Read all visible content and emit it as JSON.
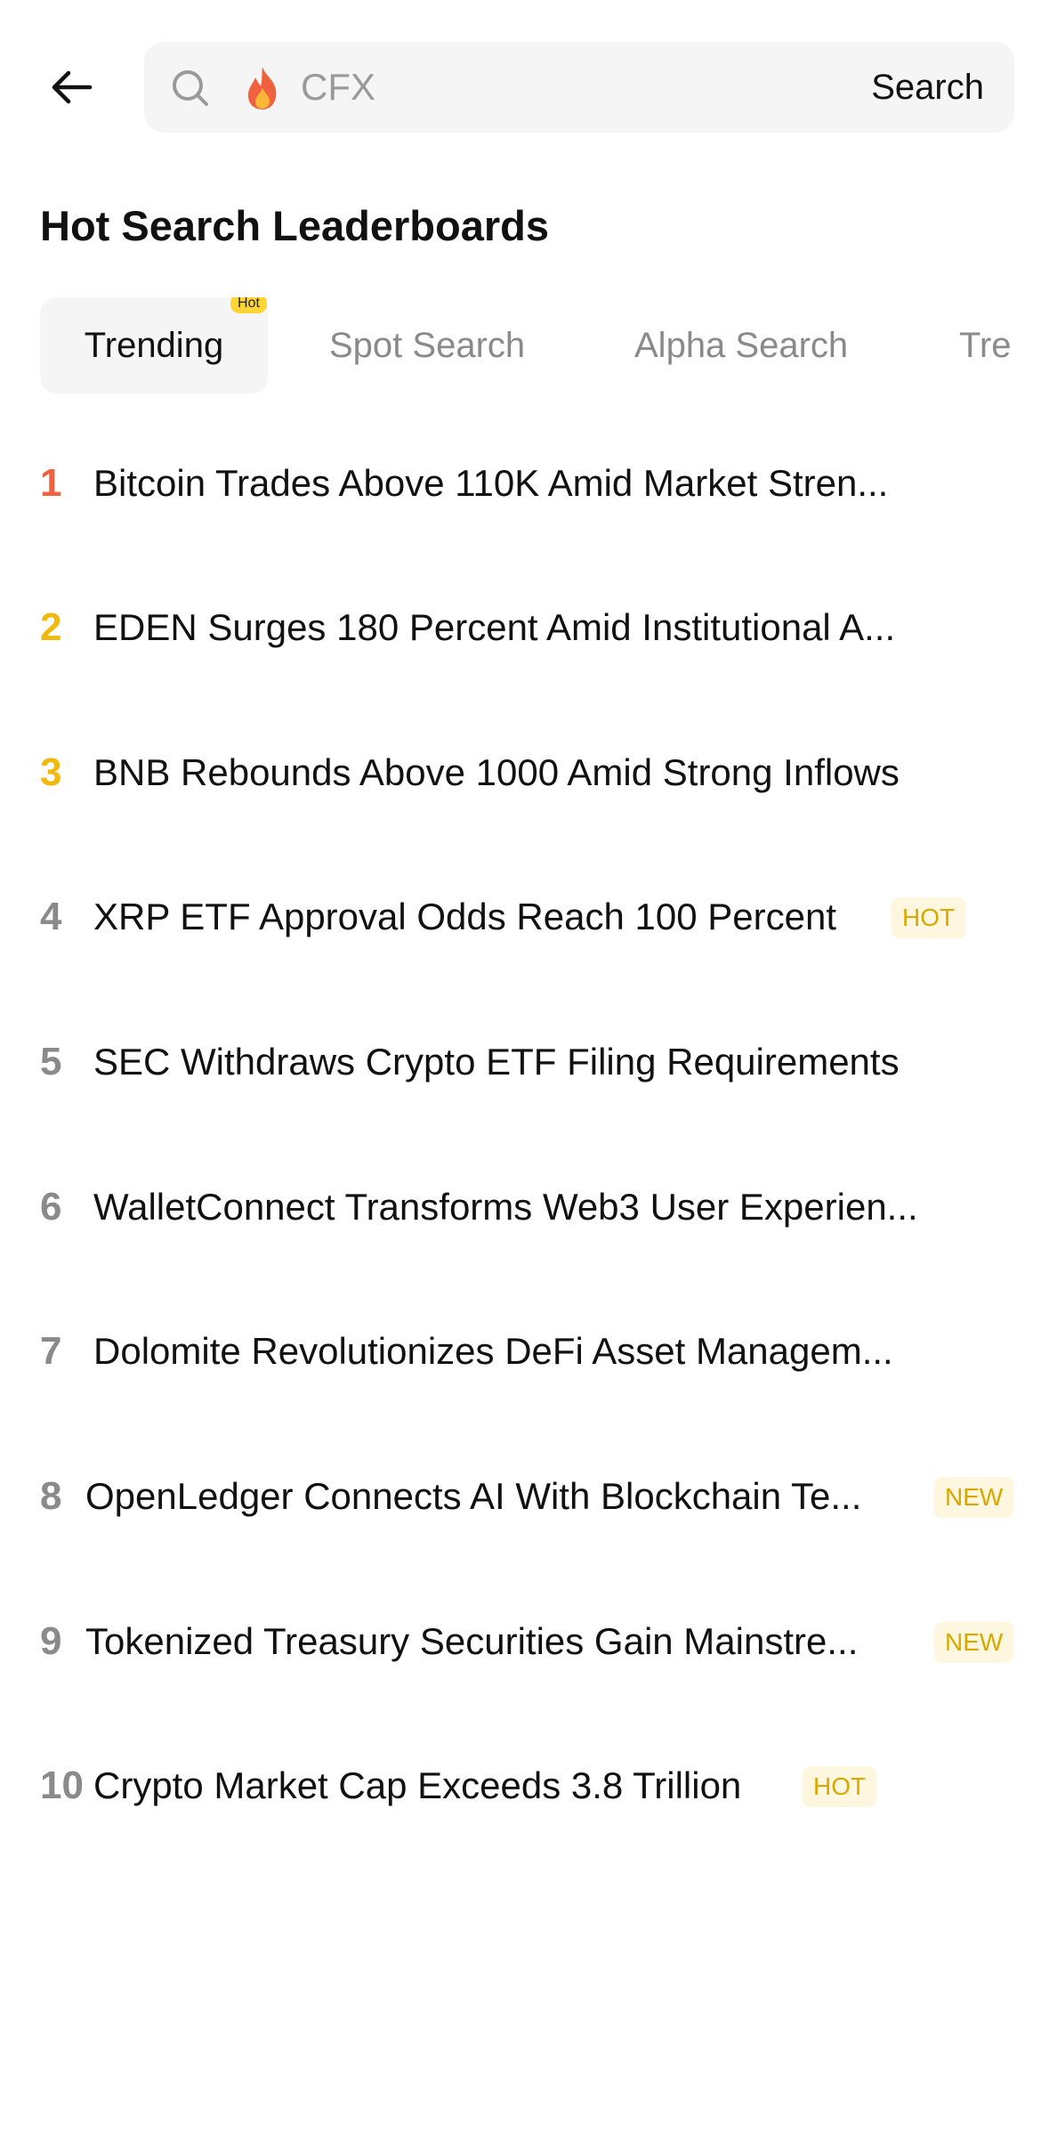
{
  "header": {
    "search": {
      "placeholder": "CFX",
      "submit_label": "Search"
    }
  },
  "section": {
    "title": "Hot Search Leaderboards"
  },
  "tabs": [
    {
      "label": "Trending",
      "badge": "Hot",
      "active": true
    },
    {
      "label": "Spot Search",
      "active": false
    },
    {
      "label": "Alpha Search",
      "active": false
    },
    {
      "label": "Tre",
      "active": false
    }
  ],
  "list": [
    {
      "rank": "1",
      "title": "Bitcoin Trades Above 110K Amid Market Stren...",
      "tag": ""
    },
    {
      "rank": "2",
      "title": "EDEN Surges 180 Percent Amid Institutional A...",
      "tag": ""
    },
    {
      "rank": "3",
      "title": "BNB Rebounds Above 1000 Amid Strong Inflows",
      "tag": ""
    },
    {
      "rank": "4",
      "title": "XRP ETF Approval Odds Reach 100 Percent",
      "tag": "HOT"
    },
    {
      "rank": "5",
      "title": "SEC Withdraws Crypto ETF Filing Requirements",
      "tag": ""
    },
    {
      "rank": "6",
      "title": "WalletConnect Transforms Web3 User Experien...",
      "tag": ""
    },
    {
      "rank": "7",
      "title": "Dolomite Revolutionizes DeFi Asset Managem...",
      "tag": ""
    },
    {
      "rank": "8",
      "title": "OpenLedger Connects AI With Blockchain Te...",
      "tag": "NEW"
    },
    {
      "rank": "9",
      "title": "Tokenized Treasury Securities Gain Mainstre...",
      "tag": "NEW"
    },
    {
      "rank": "10",
      "title": "Crypto Market Cap Exceeds 3.8 Trillion",
      "tag": "HOT"
    }
  ],
  "colors": {
    "rank1": "#f0623f",
    "rank2_3": "#f0b90b",
    "tag_text": "#d9a800",
    "tag_bg": "#fdf7e0",
    "badge_bg": "#fcd535"
  }
}
